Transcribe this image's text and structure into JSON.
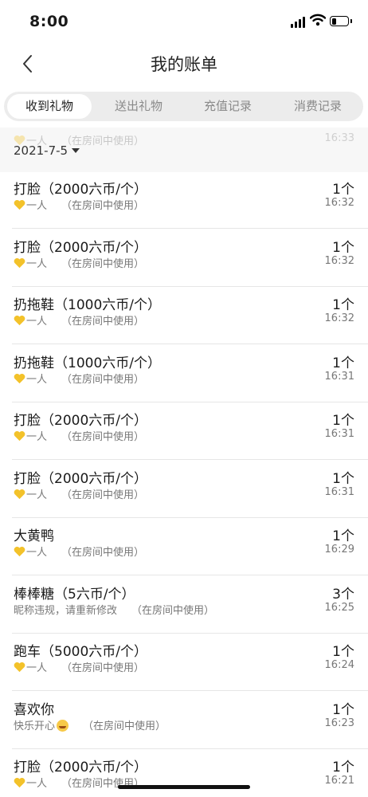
{
  "status_bar": {
    "time": "8:00",
    "battery_level": 0.3
  },
  "nav": {
    "title": "我的账单",
    "back_icon": "chevron-left-icon"
  },
  "tabs": [
    {
      "label": "收到礼物",
      "active": true
    },
    {
      "label": "送出礼物",
      "active": false
    },
    {
      "label": "充值记录",
      "active": false
    },
    {
      "label": "消费记录",
      "active": false
    }
  ],
  "sticky_header": {
    "date": "2021-7-5",
    "hidden_row_sub": "一人",
    "hidden_row_note": "（在房间中使用）",
    "hidden_row_time": "16:33"
  },
  "records": [
    {
      "title": "打脸（2000六币/个）",
      "sender": "一人",
      "heart": true,
      "note": "（在房间中使用）",
      "count": "1个",
      "time": "16:32"
    },
    {
      "title": "打脸（2000六币/个）",
      "sender": "一人",
      "heart": true,
      "note": "（在房间中使用）",
      "count": "1个",
      "time": "16:32"
    },
    {
      "title": "扔拖鞋（1000六币/个）",
      "sender": "一人",
      "heart": true,
      "note": "（在房间中使用）",
      "count": "1个",
      "time": "16:32"
    },
    {
      "title": "扔拖鞋（1000六币/个）",
      "sender": "一人",
      "heart": true,
      "note": "（在房间中使用）",
      "count": "1个",
      "time": "16:31"
    },
    {
      "title": "打脸（2000六币/个）",
      "sender": "一人",
      "heart": true,
      "note": "（在房间中使用）",
      "count": "1个",
      "time": "16:31"
    },
    {
      "title": "打脸（2000六币/个）",
      "sender": "一人",
      "heart": true,
      "note": "（在房间中使用）",
      "count": "1个",
      "time": "16:31"
    },
    {
      "title": "大黄鸭",
      "sender": "一人",
      "heart": true,
      "note": "（在房间中使用）",
      "count": "1个",
      "time": "16:29"
    },
    {
      "title": "棒棒糖（5六币/个）",
      "sender": "昵称违规，请重新修改",
      "heart": false,
      "note": "（在房间中使用）",
      "count": "3个",
      "time": "16:25"
    },
    {
      "title": "跑车（5000六币/个）",
      "sender": "一人",
      "heart": true,
      "note": "（在房间中使用）",
      "count": "1个",
      "time": "16:24"
    },
    {
      "title": "喜欢你",
      "sender": "快乐开心",
      "heart": false,
      "smile": true,
      "note": "（在房间中使用）",
      "count": "1个",
      "time": "16:23"
    },
    {
      "title": "打脸（2000六币/个）",
      "sender": "一人",
      "heart": true,
      "note": "（在房间中使用）",
      "count": "1个",
      "time": "16:21"
    }
  ]
}
